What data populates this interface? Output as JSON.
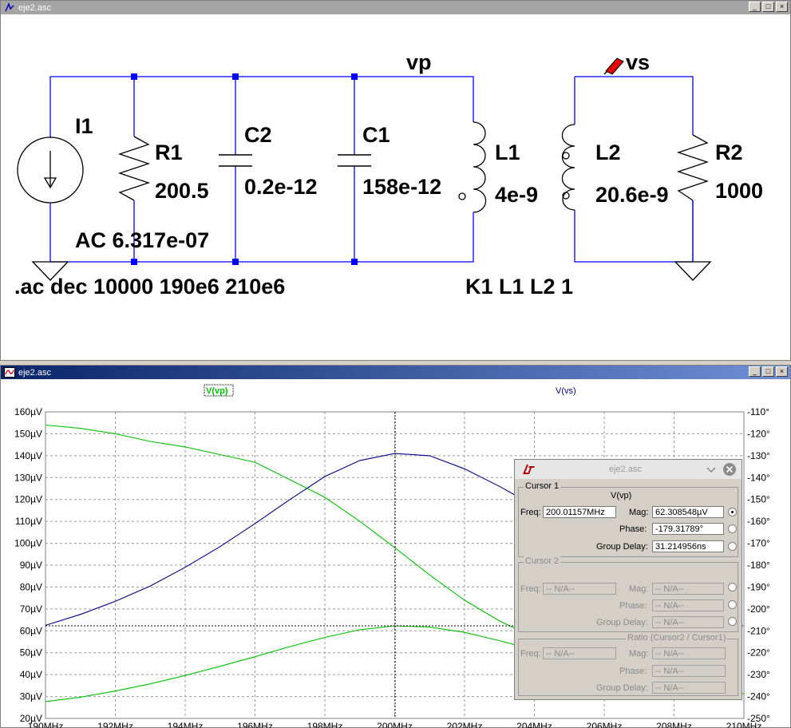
{
  "schematic_window": {
    "title": "eje2.asc",
    "controls": [
      "_",
      "□",
      "×"
    ],
    "labels": {
      "net_vp": "vp",
      "net_vs": "vs",
      "i1_name": "I1",
      "i1_value": "AC 6.317e-07",
      "r1_name": "R1",
      "r1_value": "200.5",
      "c2_name": "C2",
      "c2_value": "0.2e-12",
      "c1_name": "C1",
      "c1_value": "158e-12",
      "l1_name": "L1",
      "l1_value": "4e-9",
      "l2_name": "L2",
      "l2_value": "20.6e-9",
      "r2_name": "R2",
      "r2_value": "1000",
      "ac_directive": ".ac dec 10000 190e6 210e6",
      "coupling_directive": "K1 L1 L2 1"
    },
    "colors": {
      "wire": "#0000ff",
      "component": "#000000"
    }
  },
  "plot_window": {
    "title": "eje2.asc",
    "controls": [
      "_",
      "□",
      "×"
    ]
  },
  "chart_data": {
    "type": "line",
    "x_label_ticks": [
      "190MHz",
      "192MHz",
      "194MHz",
      "196MHz",
      "198MHz",
      "200MHz",
      "202MHz",
      "204MHz",
      "206MHz",
      "208MHz",
      "210MHz"
    ],
    "xlim_mhz": [
      190,
      210
    ],
    "y_left_ticks": [
      "160µV",
      "150µV",
      "140µV",
      "130µV",
      "120µV",
      "110µV",
      "100µV",
      "90µV",
      "80µV",
      "70µV",
      "60µV",
      "50µV",
      "40µV",
      "30µV",
      "20µV"
    ],
    "ylim_uv": [
      20,
      160
    ],
    "y_right_ticks": [
      "-110°",
      "-120°",
      "-130°",
      "-140°",
      "-150°",
      "-160°",
      "-170°",
      "-180°",
      "-190°",
      "-200°",
      "-210°",
      "-220°",
      "-230°",
      "-240°",
      "-250°"
    ],
    "ylim_deg": [
      -250,
      -110
    ],
    "grid": true,
    "series": [
      {
        "name": "V(vp)",
        "kind": "magnitude",
        "color": "#00c000",
        "x": [
          190,
          191,
          192,
          193,
          194,
          195,
          196,
          197,
          198,
          199,
          200,
          201,
          202,
          203,
          204,
          205,
          206,
          207,
          208,
          209,
          210
        ],
        "y": [
          27.7,
          29.7,
          32.5,
          35.8,
          39.6,
          43.8,
          48.2,
          52.8,
          57.0,
          60.5,
          62.3,
          61.7,
          59.3,
          55.5,
          51.3,
          47.0,
          43.0,
          39.4,
          36.3,
          33.6,
          31.3
        ]
      },
      {
        "name": "V(vp)",
        "kind": "phase",
        "color": "#00c000",
        "x": [
          190,
          191,
          192,
          193,
          194,
          195,
          196,
          197,
          198,
          199,
          200,
          201,
          202,
          203,
          204
        ],
        "y": [
          -116.0,
          -117.5,
          -120.0,
          -123.5,
          -126.0,
          -129.5,
          -133.0,
          -141.0,
          -149.0,
          -160.0,
          -172.0,
          -184.5,
          -196.0,
          -205.5,
          -213.0
        ]
      },
      {
        "name": "V(vs)",
        "kind": "magnitude",
        "color": "#00008b",
        "x": [
          190,
          191,
          192,
          193,
          194,
          195,
          196,
          197,
          198,
          199,
          200,
          201,
          202,
          203,
          204
        ],
        "y": [
          62.5,
          67.5,
          73.5,
          80.5,
          89.0,
          98.5,
          109.0,
          120.0,
          130.5,
          137.8,
          141.0,
          140.0,
          134.0,
          126.0,
          117.0
        ]
      }
    ],
    "cursor": {
      "x_mhz": 200.01157,
      "y_uv": 62.308548
    }
  },
  "cursor_dialog": {
    "title": "eje2.asc",
    "cursor1": {
      "group_title": "Cursor 1",
      "trace": "V(vp)",
      "freq_label": "Freq:",
      "freq": "200.01157MHz",
      "mag_label": "Mag:",
      "mag": "62.308548µV",
      "phase_label": "Phase:",
      "phase": "-179.31789°",
      "gd_label": "Group Delay:",
      "gd": "31.214956ns"
    },
    "cursor2": {
      "group_title": "Cursor 2",
      "freq_label": "Freq:",
      "freq": "-- N/A--",
      "mag_label": "Mag:",
      "mag": "-- N/A--",
      "phase_label": "Phase:",
      "phase": "-- N/A--",
      "gd_label": "Group Delay:",
      "gd": "-- N/A--"
    },
    "ratio": {
      "group_title": "Ratio (Cursor2 / Cursor1)",
      "freq_label": "Freq:",
      "freq": "-- N/A--",
      "mag_label": "Mag:",
      "mag": "-- N/A--",
      "phase_label": "Phase:",
      "phase": "-- N/A--",
      "gd_label": "Group Delay:",
      "gd": "-- N/A--"
    }
  }
}
